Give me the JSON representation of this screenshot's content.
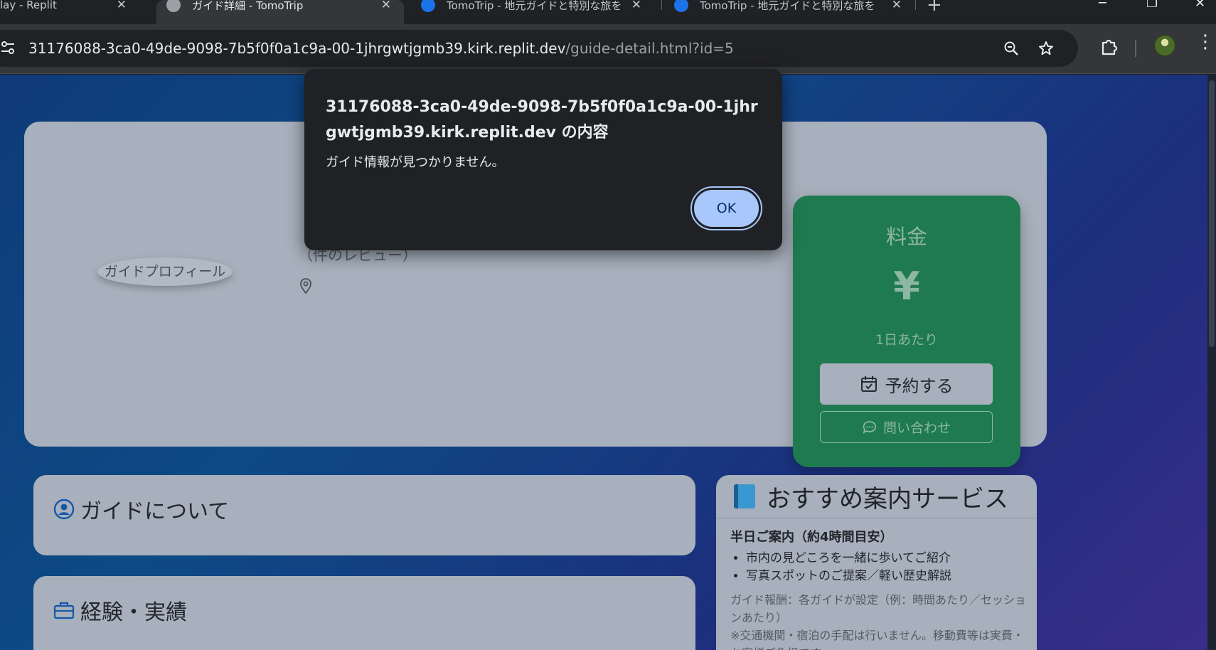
{
  "browser": {
    "tabs": [
      {
        "title": "lay - Replit"
      },
      {
        "title": "ガイド詳細 - TomoTrip"
      },
      {
        "title": "TomoTrip - 地元ガイドと特別な旅を"
      },
      {
        "title": "TomoTrip - 地元ガイドと特別な旅を"
      }
    ],
    "url_host": "31176088-3ca0-49de-9098-7b5f0f0a1c9a-00-1jhrgwtjgmb39.kirk.replit.dev",
    "url_path": "/guide-detail.html?id=5"
  },
  "dialog": {
    "origin": "31176088-3ca0-49de-9098-7b5f0f0a1c9a-00-1jhrgwtjgmb39.kirk.replit.dev の内容",
    "message": "ガイド情報が見つかりません。",
    "ok_label": "OK"
  },
  "profile": {
    "image_alt": "ガイドプロフィール",
    "reviews": "（件のレビュー）"
  },
  "price": {
    "title": "料金",
    "currency": "¥",
    "unit": "1日あたり",
    "book_label": "予約する",
    "inquiry_label": "問い合わせ"
  },
  "sections": {
    "about_title": "ガイドについて",
    "experience_title": "経験・実績"
  },
  "service": {
    "title": "おすすめ案内サービス",
    "subtitle": "半日ご案内（約4時間目安）",
    "items": [
      "市内の見どころを一緒に歩いてご紹介",
      "写真スポットのご提案／軽い歴史解説"
    ],
    "note1": "ガイド報酬：各ガイドが設定（例：時間あたり／セッションあたり）",
    "note2": "※交通機関・宿泊の手配は行いません。移動費等は実費・お客様ご負担です。"
  },
  "icons": [
    "site-info-icon",
    "zoom-icon",
    "bookmark-star-icon",
    "extensions-icon",
    "profile-avatar",
    "menu-icon",
    "location-pin-icon",
    "calendar-check-icon",
    "chat-bubble-icon",
    "user-circle-icon",
    "briefcase-icon",
    "blue-book-icon"
  ],
  "colors": {
    "accent_blue": "#1a73e8",
    "price_card_green": "#1f7a50",
    "ok_button": "#a8c7fa"
  }
}
